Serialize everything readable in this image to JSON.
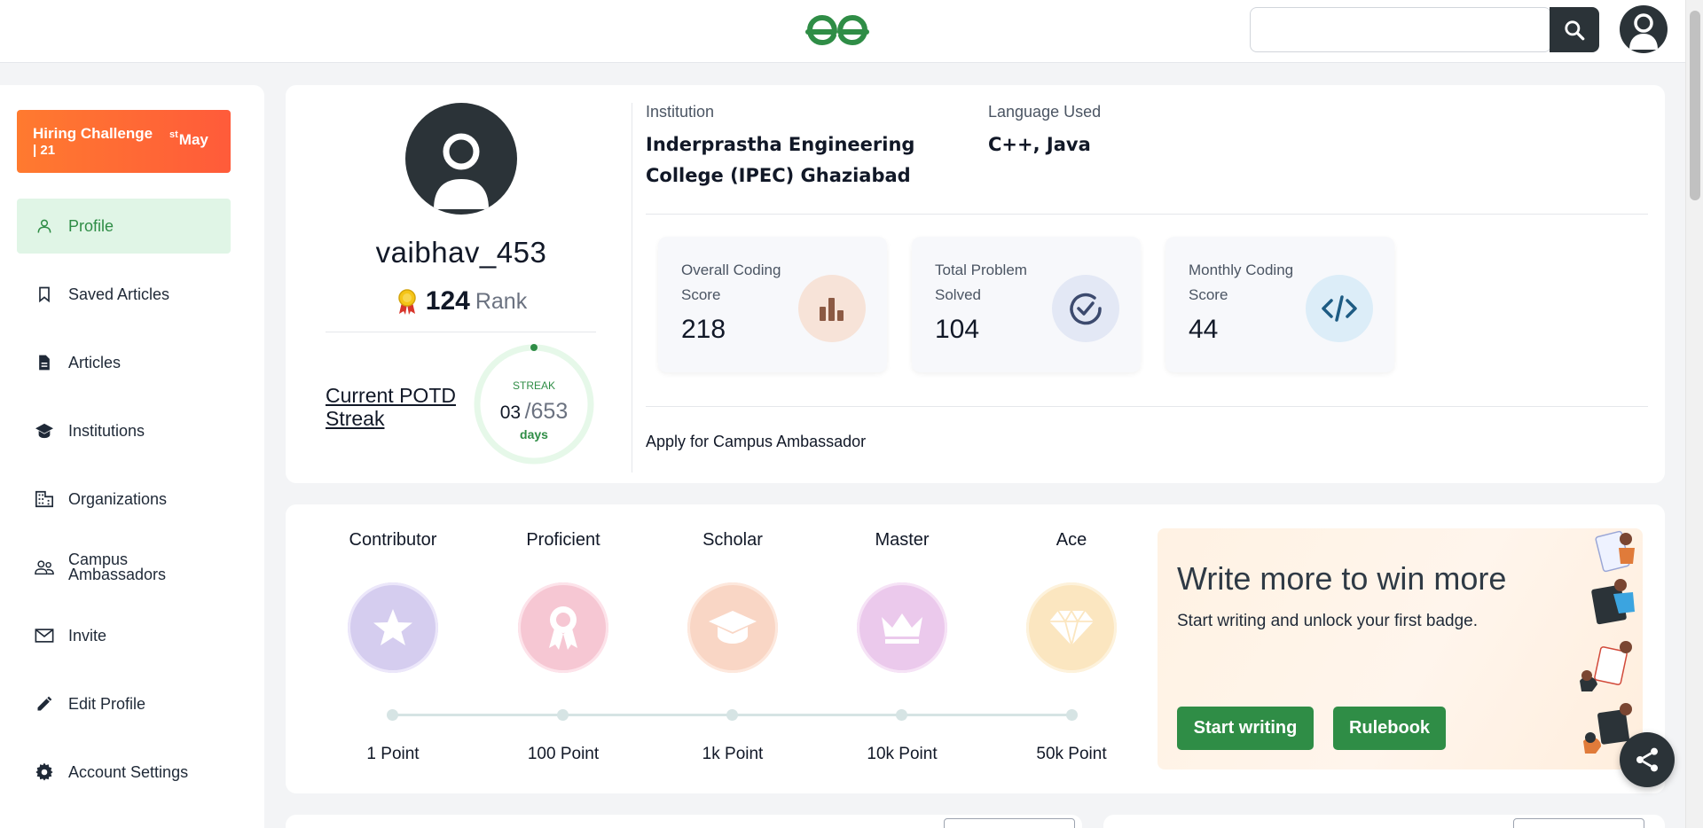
{
  "header": {
    "logo_icon": "gfg-logo-icon",
    "search_placeholder": "",
    "search_icon": "search-icon",
    "avatar_icon": "user-avatar-icon"
  },
  "sidebar": {
    "hiring": {
      "line1": "Hiring Challenge",
      "line2": "| 21",
      "sup": "st",
      "month": "May"
    },
    "items": [
      {
        "label": "Profile",
        "icon": "person-icon",
        "active": true
      },
      {
        "label": "Saved Articles",
        "icon": "bookmark-icon"
      },
      {
        "label": "Articles",
        "icon": "document-icon"
      },
      {
        "label": "Institutions",
        "icon": "graduation-cap-icon"
      },
      {
        "label": "Organizations",
        "icon": "building-icon"
      },
      {
        "label": "Campus\nAmbassadors",
        "icon": "people-icon"
      },
      {
        "label": "Invite",
        "icon": "mail-icon"
      },
      {
        "label": "Edit Profile",
        "icon": "pencil-icon"
      },
      {
        "label": "Account Settings",
        "icon": "gear-icon"
      }
    ]
  },
  "profile": {
    "username": "vaibhav_453",
    "rank": "124",
    "rank_label": "Rank",
    "potd_link": "Current POTD Streak",
    "streak_label": "STREAK",
    "streak_current": "03",
    "streak_total": "/653",
    "streak_days": "days",
    "institution_label": "Institution",
    "institution_value": "Inderprastha Engineering College (IPEC) Ghaziabad",
    "language_label": "Language Used",
    "language_value": "C++, Java",
    "stats": [
      {
        "label": "Overall Coding Score",
        "value": "218",
        "icon": "bar-chart-icon"
      },
      {
        "label": "Total Problem Solved",
        "value": "104",
        "icon": "check-circle-icon"
      },
      {
        "label": "Monthly Coding Score",
        "value": "44",
        "icon": "code-icon"
      }
    ],
    "apply_link": "Apply for Campus Ambassador"
  },
  "badges": [
    {
      "title": "Contributor",
      "points": "1 Point",
      "icon": "star-icon"
    },
    {
      "title": "Proficient",
      "points": "100 Point",
      "icon": "ribbon-icon"
    },
    {
      "title": "Scholar",
      "points": "1k Point",
      "icon": "graduation-cap-icon"
    },
    {
      "title": "Master",
      "points": "10k Point",
      "icon": "crown-icon"
    },
    {
      "title": "Ace",
      "points": "50k Point",
      "icon": "diamond-icon"
    }
  ],
  "promo": {
    "title": "Write more to win more",
    "subtitle": "Start writing and unlock your first badge.",
    "start_button": "Start writing",
    "rulebook_button": "Rulebook"
  },
  "share_icon": "share-icon",
  "colors": {
    "brand_green": "#2f8d46",
    "dark": "#2b3338",
    "hiring_orange": "#ff6b35"
  }
}
